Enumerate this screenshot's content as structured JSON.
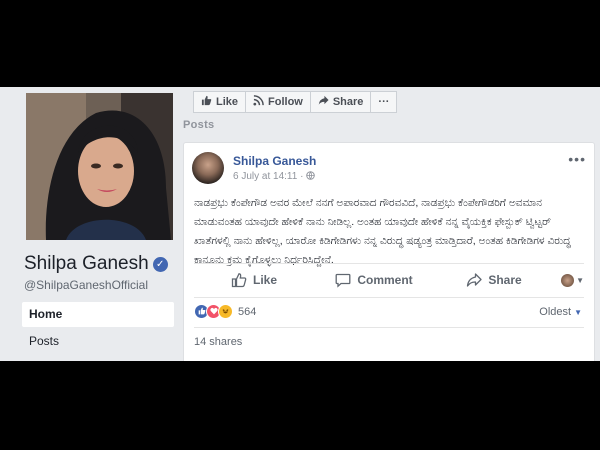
{
  "profile": {
    "name": "Shilpa Ganesh",
    "handle": "@ShilpaGaneshOfficial",
    "verified_symbol": "✓"
  },
  "nav": {
    "items": [
      {
        "label": "Home",
        "active": true
      },
      {
        "label": "Posts",
        "active": false
      }
    ]
  },
  "actions": {
    "like": "Like",
    "follow": "Follow",
    "share": "Share",
    "more": "···"
  },
  "posts_label": "Posts",
  "post": {
    "author": "Shilpa Ganesh",
    "date": "6 July at 14:11 · ",
    "text": "ನಾಡಪ್ರಭು ಕೆಂಪೇಗೌಡ ಅವರ ಮೇಲೆ ನನಗೆ ಅಪಾರವಾದ ಗೌರವವಿದೆ, ನಾಡಪ್ರಭು ಕೆಂಪೇಗೌಡರಿಗೆ ಅವಮಾನ ಮಾಡುವಂತಹ ಯಾವುದೇ ಹೇಳಿಕೆ ನಾನು ನೀಡಿಲ್ಲ. ಅಂತಹ ಯಾವುದೇ ಹೇಳಿಕೆ ನನ್ನ ವೈಯಕ್ತಿಕ ಫೇಸ್ಬುಕ್ ಟ್ವಿಟ್ಟರ್ ಖಾತೆಗಳಲ್ಲಿ ನಾನು ಹೇಳಿಲ್ಲ, ಯಾರೋ ಕಿಡಿಗೇಡಿಗಳು ನನ್ನ ವಿರುದ್ಧ ಷಡ್ಯಂತ್ರ ಮಾಡ್ತಿದಾರೆ, ಅಂತಹ ಕಿಡಿಗೇಡಿಗಳ ವಿರುದ್ಧ ಕಾನೂನು ಕ್ರಮ ಕೈಗೊಳ್ಳಲು ನಿರ್ಧರಿಸಿದ್ದೇನೆ.",
    "like_label": "Like",
    "comment_label": "Comment",
    "share_label": "Share",
    "reaction_count": "564",
    "sort_label": "Oldest",
    "shares_label": "14 shares"
  },
  "colors": {
    "link_blue": "#385898",
    "fb_blue": "#4267b2",
    "page_bg": "#e9ebee"
  }
}
